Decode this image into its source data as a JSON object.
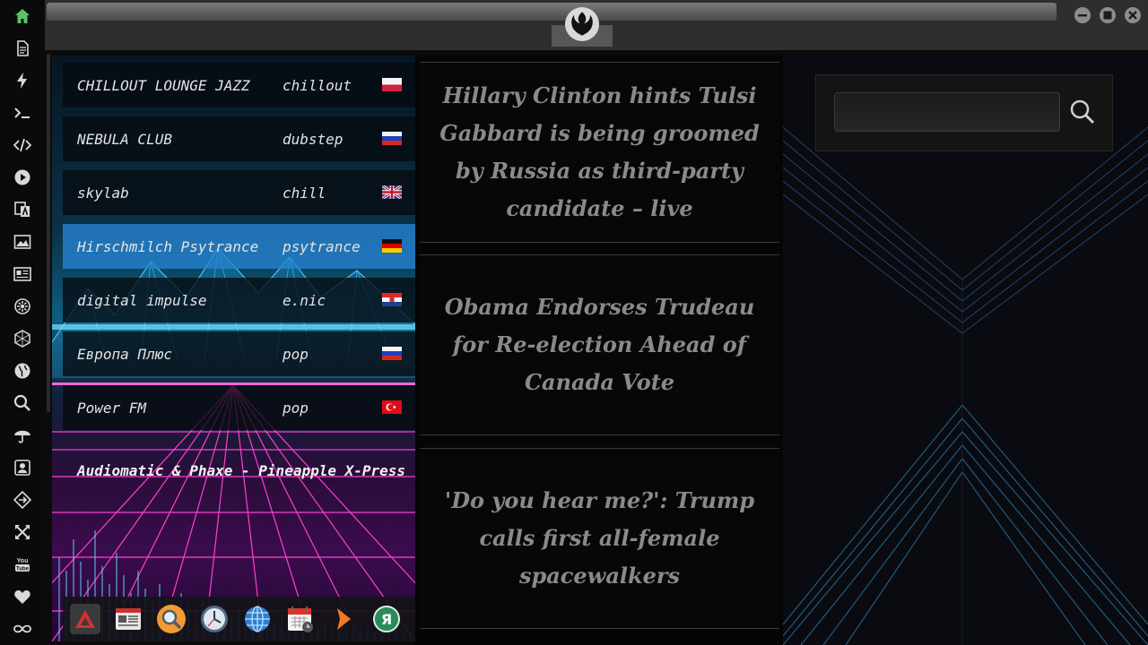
{
  "window": {
    "logo": "rebel-alliance-icon",
    "controls": [
      "minimize-icon",
      "maximize-icon",
      "close-icon"
    ]
  },
  "sidebar": {
    "items": [
      {
        "name": "home",
        "icon": "home-icon",
        "active": true
      },
      {
        "name": "documents",
        "icon": "document-icon"
      },
      {
        "name": "power",
        "icon": "lightning-icon"
      },
      {
        "name": "terminal",
        "icon": "terminal-icon"
      },
      {
        "name": "code",
        "icon": "code-icon"
      },
      {
        "name": "media",
        "icon": "play-icon"
      },
      {
        "name": "translate",
        "icon": "translate-icon"
      },
      {
        "name": "images",
        "icon": "image-icon"
      },
      {
        "name": "news",
        "icon": "newspaper-icon"
      },
      {
        "name": "settings",
        "icon": "cog-icon"
      },
      {
        "name": "network",
        "icon": "hex-network-icon"
      },
      {
        "name": "web",
        "icon": "globe-icon"
      },
      {
        "name": "search",
        "icon": "search-icon"
      },
      {
        "name": "weather",
        "icon": "umbrella-icon"
      },
      {
        "name": "contacts",
        "icon": "contact-icon"
      },
      {
        "name": "routing",
        "icon": "diamond-arrows-icon"
      },
      {
        "name": "fullscreen",
        "icon": "expand-icon"
      },
      {
        "name": "youtube",
        "icon": "youtube-icon"
      },
      {
        "name": "favorites",
        "icon": "heart-icon"
      },
      {
        "name": "infinity",
        "icon": "infinity-icon"
      }
    ]
  },
  "radio": {
    "stations": [
      {
        "name": "CHILLOUT LOUNGE JAZZ",
        "genre": "chillout",
        "flag": "PL"
      },
      {
        "name": "NEBULA CLUB",
        "genre": "dubstep",
        "flag": "RU"
      },
      {
        "name": "skylab",
        "genre": "chill",
        "flag": "GB"
      },
      {
        "name": "Hirschmilch Psytrance",
        "genre": "psytrance",
        "flag": "DE",
        "selected": true
      },
      {
        "name": "digital impulse",
        "genre": "e.nic",
        "flag": "HR"
      },
      {
        "name": "Европа Плюс",
        "genre": "pop",
        "flag": "RU"
      },
      {
        "name": "Power FM",
        "genre": "pop",
        "flag": "TR"
      }
    ],
    "now_playing": "Audiomatic & Phaxe - Pineapple X-Press"
  },
  "dock": {
    "items": [
      "red-triangle-app-icon",
      "news-app-icon",
      "magnifier-app-icon",
      "clock-app-icon",
      "globe-app-icon",
      "calendar-app-icon",
      "arrow-app-icon",
      "yandex-app-icon"
    ]
  },
  "news": {
    "headlines": [
      "Hillary Clinton hints Tulsi Gabbard is being groomed by Russia as third-party candidate – live",
      "Obama Endorses Trudeau for Re-election Ahead of Canada Vote",
      "'Do you hear me?': Trump calls first all-female spacewalkers"
    ]
  },
  "search": {
    "value": "",
    "placeholder": ""
  }
}
